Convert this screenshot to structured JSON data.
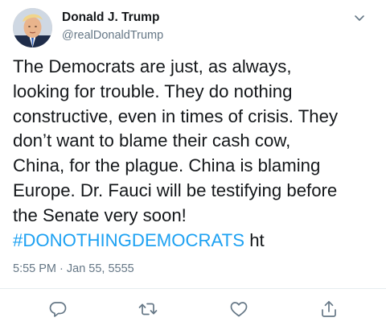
{
  "tweet": {
    "author_name": "Donald J. Trump",
    "author_handle": "@realDonaldTrump",
    "text_lines": [
      "The Democrats are just, as always,",
      "looking for trouble. They do nothing",
      "constructive, even in times of crisis. They",
      "don’t want to blame their cash cow,",
      "China, for the plague. China is blaming",
      "Europe. Dr. Fauci will be testifying before",
      "the Senate very soon!"
    ],
    "hashtag": "#DONOTHINGDEMOCRATS",
    "trailing_text": " ht",
    "timestamp": "5:55 PM · Jan 55, 5555"
  },
  "icons": {
    "menu": "chevron-down-icon",
    "reply": "reply-icon",
    "retweet": "retweet-icon",
    "like": "heart-icon",
    "share": "share-icon"
  },
  "colors": {
    "text": "#14171a",
    "secondary": "#657786",
    "link": "#1da1f2",
    "divider": "#e6ecf0"
  }
}
